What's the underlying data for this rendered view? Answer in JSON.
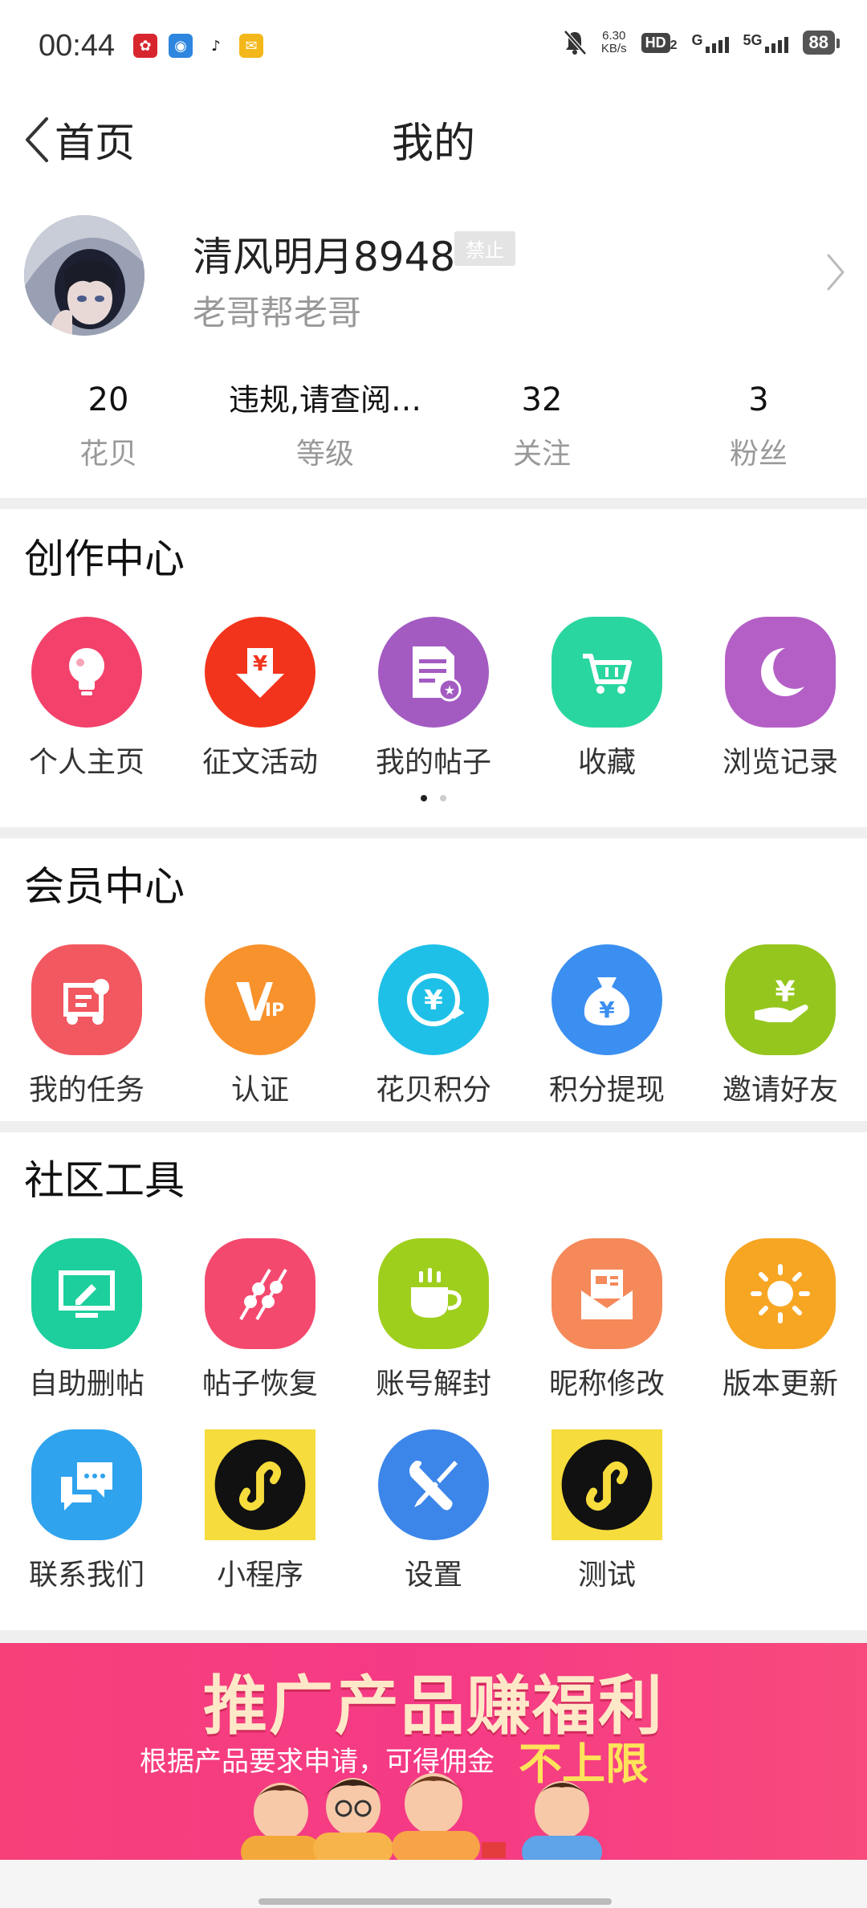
{
  "status_bar": {
    "time": "00:44",
    "speed_value": "6.30",
    "speed_unit": "KB/s",
    "hd": "HD",
    "hd_sub": "2",
    "net1": "G",
    "net2": "5G",
    "battery": "88"
  },
  "nav": {
    "back_label": "首页",
    "title": "我的"
  },
  "profile": {
    "username": "清风明月8948",
    "badge": "禁止",
    "signature": "老哥帮老哥"
  },
  "stats": [
    {
      "value": "20",
      "label": "花贝"
    },
    {
      "value": "违规,请查阅…",
      "label": "等级"
    },
    {
      "value": "32",
      "label": "关注"
    },
    {
      "value": "3",
      "label": "粉丝"
    }
  ],
  "creation": {
    "title": "创作中心",
    "items": [
      {
        "label": "个人主页",
        "icon": "lightbulb-icon",
        "color": "#f2416a"
      },
      {
        "label": "征文活动",
        "icon": "yuan-download-icon",
        "color": "#f2341c"
      },
      {
        "label": "我的帖子",
        "icon": "post-document-icon",
        "color": "#a35bc2"
      },
      {
        "label": "收藏",
        "icon": "cart-icon",
        "color": "#2ad6a0"
      },
      {
        "label": "浏览记录",
        "icon": "moon-icon",
        "color": "#b45fc6"
      }
    ]
  },
  "member": {
    "title": "会员中心",
    "items": [
      {
        "label": "我的任务",
        "icon": "task-icon",
        "color": "#f25860"
      },
      {
        "label": "认证",
        "icon": "vip-icon",
        "color": "#f8922c"
      },
      {
        "label": "花贝积分",
        "icon": "yuan-circle-icon",
        "color": "#1fc0e8"
      },
      {
        "label": "积分提现",
        "icon": "money-bag-icon",
        "color": "#3b8ff0"
      },
      {
        "label": "邀请好友",
        "icon": "hand-yuan-icon",
        "color": "#95c61e"
      }
    ]
  },
  "tools": {
    "title": "社区工具",
    "items": [
      {
        "label": "自助删帖",
        "icon": "monitor-edit-icon",
        "color": "#1ccf9c"
      },
      {
        "label": "帖子恢复",
        "icon": "skewer-icon",
        "color": "#f4496e"
      },
      {
        "label": "账号解封",
        "icon": "coffee-cup-icon",
        "color": "#9fcf1d"
      },
      {
        "label": "昵称修改",
        "icon": "envelope-card-icon",
        "color": "#f5895a"
      },
      {
        "label": "版本更新",
        "icon": "sun-icon",
        "color": "#f7a623"
      },
      {
        "label": "联系我们",
        "icon": "chat-bubbles-icon",
        "color": "#2fa3ee"
      },
      {
        "label": "小程序",
        "icon": "mini-program-icon",
        "color": "#f6dc3c"
      },
      {
        "label": "设置",
        "icon": "wrench-screwdriver-icon",
        "color": "#3c86ea"
      },
      {
        "label": "测试",
        "icon": "mini-program-icon",
        "color": "#f6dc3c"
      }
    ]
  },
  "banner": {
    "title": "推广产品赚福利",
    "subtitle": "根据产品要求申请，可得佣金",
    "highlight": "不上限"
  }
}
